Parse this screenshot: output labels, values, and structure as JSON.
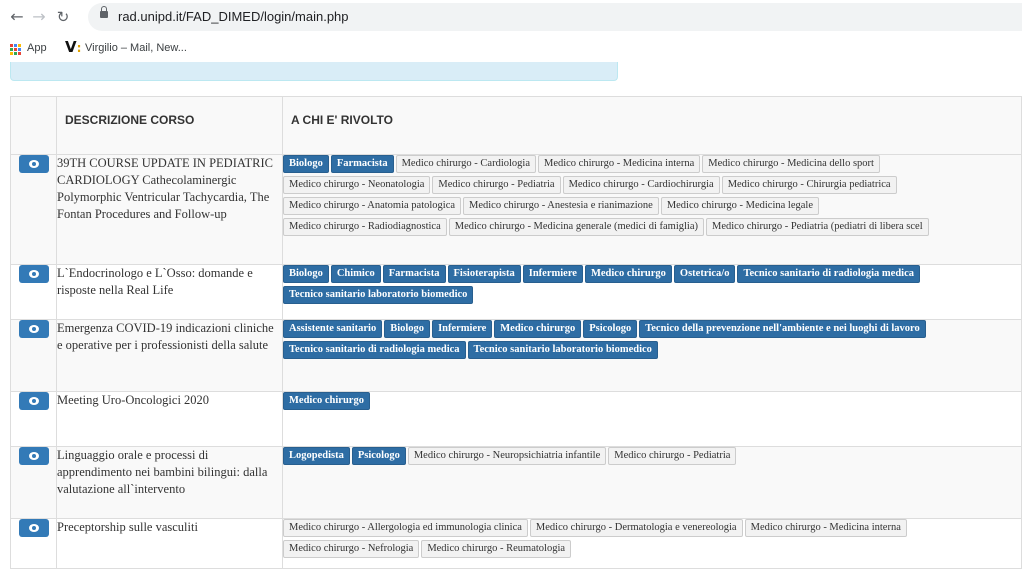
{
  "browser": {
    "url": "rad.unipd.it/FAD_DIMED/login/main.php",
    "bookmarks": [
      {
        "label": "App"
      },
      {
        "label": "Virgilio – Mail, New..."
      }
    ]
  },
  "colors": {
    "primary_tag": "#2e6da4",
    "secondary_tag": "#f2f2f2",
    "view_button": "#337ab7",
    "info_box": "#d9edf7"
  },
  "icons": {
    "back": "arrow-left",
    "forward": "arrow-right",
    "reload": "reload",
    "lock": "lock",
    "apps": "apps-grid",
    "virgilio": "virgilio-logo",
    "view": "eye"
  },
  "table": {
    "headers": [
      "",
      "DESCRIZIONE CORSO",
      "A CHI E' RIVOLTO"
    ],
    "rows": [
      {
        "title": "39TH COURSE UPDATE IN PEDIATRIC CARDIOLOGY Cathecolaminergic Polymorphic Ventricular Tachycardia, The Fontan Procedures and Follow-up",
        "tag_lines": [
          [
            {
              "label": "Biologo",
              "primary": true
            },
            {
              "label": "Farmacista",
              "primary": true
            },
            {
              "label": "Medico chirurgo - Cardiologia",
              "primary": false
            },
            {
              "label": "Medico chirurgo - Medicina interna",
              "primary": false
            },
            {
              "label": "Medico chirurgo - Medicina dello sport",
              "primary": false
            }
          ],
          [
            {
              "label": "Medico chirurgo - Neonatologia",
              "primary": false
            },
            {
              "label": "Medico chirurgo - Pediatria",
              "primary": false
            },
            {
              "label": "Medico chirurgo - Cardiochirurgia",
              "primary": false
            },
            {
              "label": "Medico chirurgo - Chirurgia pediatrica",
              "primary": false
            }
          ],
          [
            {
              "label": "Medico chirurgo - Anatomia patologica",
              "primary": false
            },
            {
              "label": "Medico chirurgo - Anestesia e rianimazione",
              "primary": false
            },
            {
              "label": "Medico chirurgo - Medicina legale",
              "primary": false
            }
          ],
          [
            {
              "label": "Medico chirurgo - Radiodiagnostica",
              "primary": false
            },
            {
              "label": "Medico chirurgo - Medicina generale (medici di famiglia)",
              "primary": false
            },
            {
              "label": "Medico chirurgo - Pediatria (pediatri di libera scel",
              "primary": false
            }
          ]
        ]
      },
      {
        "title": "L`Endocrinologo e L`Osso: domande e risposte nella Real Life",
        "tag_lines": [
          [
            {
              "label": "Biologo",
              "primary": true
            },
            {
              "label": "Chimico",
              "primary": true
            },
            {
              "label": "Farmacista",
              "primary": true
            },
            {
              "label": "Fisioterapista",
              "primary": true
            },
            {
              "label": "Infermiere",
              "primary": true
            },
            {
              "label": "Medico chirurgo",
              "primary": true
            },
            {
              "label": "Ostetrica/o",
              "primary": true
            },
            {
              "label": "Tecnico sanitario di radiologia medica",
              "primary": true
            }
          ],
          [
            {
              "label": "Tecnico sanitario laboratorio biomedico",
              "primary": true
            }
          ]
        ]
      },
      {
        "title": "Emergenza COVID-19 indicazioni cliniche e operative per i professionisti della salute",
        "tag_lines": [
          [
            {
              "label": "Assistente sanitario",
              "primary": true
            },
            {
              "label": "Biologo",
              "primary": true
            },
            {
              "label": "Infermiere",
              "primary": true
            },
            {
              "label": "Medico chirurgo",
              "primary": true
            },
            {
              "label": "Psicologo",
              "primary": true
            },
            {
              "label": "Tecnico della prevenzione nell'ambiente e nei luoghi di lavoro",
              "primary": true
            }
          ],
          [
            {
              "label": "Tecnico sanitario di radiologia medica",
              "primary": true
            },
            {
              "label": "Tecnico sanitario laboratorio biomedico",
              "primary": true
            }
          ]
        ]
      },
      {
        "title": "Meeting Uro-Oncologici 2020",
        "tag_lines": [
          [
            {
              "label": "Medico chirurgo",
              "primary": true
            }
          ]
        ]
      },
      {
        "title": "Linguaggio orale e processi di apprendimento nei bambini bilingui: dalla valutazione all`intervento",
        "tag_lines": [
          [
            {
              "label": "Logopedista",
              "primary": true
            },
            {
              "label": "Psicologo",
              "primary": true
            },
            {
              "label": "Medico chirurgo - Neuropsichiatria infantile",
              "primary": false
            },
            {
              "label": "Medico chirurgo - Pediatria",
              "primary": false
            }
          ]
        ]
      },
      {
        "title": "Preceptorship sulle vasculiti",
        "tag_lines": [
          [
            {
              "label": "Medico chirurgo - Allergologia ed immunologia clinica",
              "primary": false
            },
            {
              "label": "Medico chirurgo - Dermatologia e venereologia",
              "primary": false
            },
            {
              "label": "Medico chirurgo - Medicina interna",
              "primary": false
            }
          ],
          [
            {
              "label": "Medico chirurgo - Nefrologia",
              "primary": false
            },
            {
              "label": "Medico chirurgo - Reumatologia",
              "primary": false
            }
          ]
        ]
      }
    ]
  }
}
